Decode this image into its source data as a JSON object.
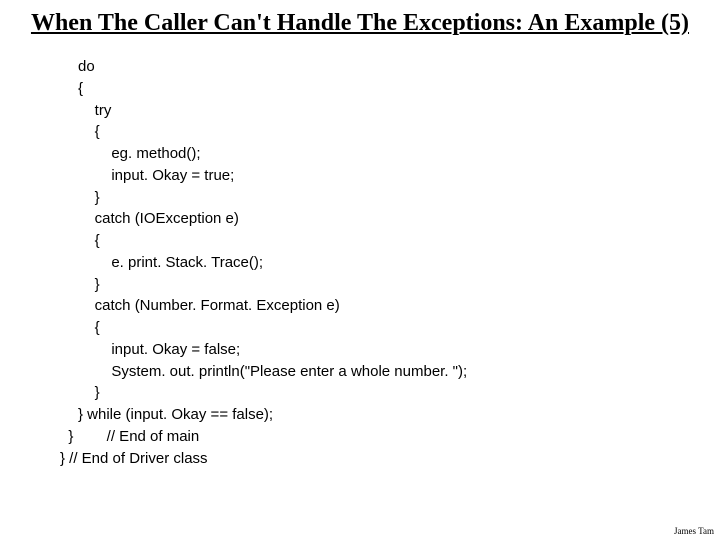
{
  "title": "When The Caller Can't Handle The Exceptions: An Example (5)",
  "code_lines": [
    "do",
    "{",
    "    try",
    "    {",
    "        eg. method();",
    "        input. Okay = true;",
    "    }",
    "    catch (IOException e)",
    "    {",
    "        e. print. Stack. Trace();",
    "    }",
    "    catch (Number. Format. Exception e)",
    "    {",
    "        input. Okay = false;",
    "        System. out. println(\"Please enter a whole number. \");",
    "    }",
    "} while (input. Okay == false);"
  ],
  "end_main": "}        // End of main",
  "end_class": "} // End of Driver class",
  "footer": "James Tam"
}
